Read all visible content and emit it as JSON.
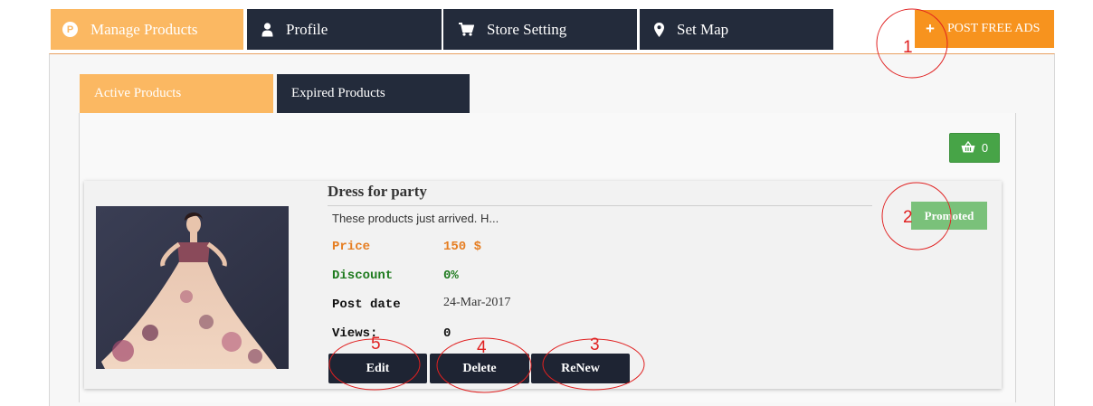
{
  "nav": {
    "tabs": [
      {
        "label": "Manage Products",
        "icon": "p-circle-icon",
        "active": true
      },
      {
        "label": "Profile",
        "icon": "user-icon",
        "active": false
      },
      {
        "label": "Store Setting",
        "icon": "cart-icon",
        "active": false
      },
      {
        "label": "Set Map",
        "icon": "map-pin-icon",
        "active": false
      }
    ],
    "post_ads_label": "POST FREE ADS"
  },
  "sub_tabs": [
    {
      "label": "Active Products",
      "active": true
    },
    {
      "label": "Expired Products",
      "active": false
    }
  ],
  "cart": {
    "count": "0"
  },
  "product": {
    "title": "Dress for party",
    "description": "These products just arrived. H...",
    "price_label": "Price",
    "price_value": "150 $",
    "discount_label": "Discount",
    "discount_value": "0%",
    "post_date_label": "Post date",
    "post_date_value": "24-Mar-2017",
    "views_label": "Views:",
    "views_value": "0",
    "badge": "Promoted",
    "buttons": {
      "edit": "Edit",
      "delete": "Delete",
      "renew": "ReNew"
    }
  },
  "annotations": [
    "1",
    "2",
    "3",
    "4",
    "5"
  ],
  "colors": {
    "nav_dark": "#232b3b",
    "active_orange": "#fbb862",
    "post_ads_orange": "#f7931e",
    "price_orange": "#e67e22",
    "discount_green": "#1d7a1d",
    "promoted_green": "#7ac17a",
    "cart_green": "#47a447",
    "annotation_red": "#e02020"
  }
}
